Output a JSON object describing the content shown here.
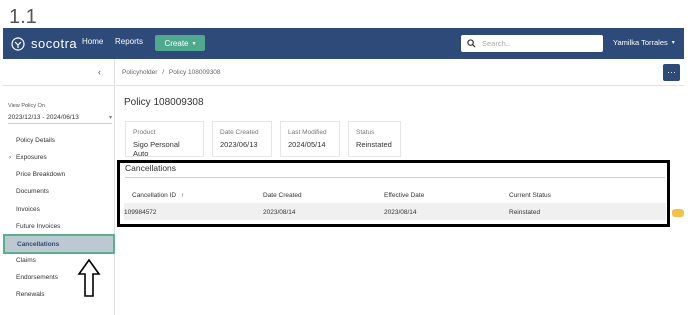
{
  "step": "1.1",
  "header": {
    "brand": "socotra",
    "nav": [
      "Home",
      "Reports"
    ],
    "create_label": "Create",
    "search_placeholder": "Search..",
    "user_name": "Yamilka Torrales"
  },
  "sidebar": {
    "view_policy_label": "View Policy On",
    "date_range": "2023/12/13 - 2024/06/13",
    "items": [
      {
        "label": "Policy Details"
      },
      {
        "label": "Exposures"
      },
      {
        "label": "Price Breakdown"
      },
      {
        "label": "Documents"
      },
      {
        "label": "Invoices"
      },
      {
        "label": "Future Invoices"
      },
      {
        "label": "Cancellations"
      },
      {
        "label": "Claims"
      },
      {
        "label": "Endorsements"
      },
      {
        "label": "Renewals"
      }
    ]
  },
  "breadcrumb": {
    "root": "Policyholder",
    "separator": "/",
    "current": "Policy 108009308"
  },
  "policy": {
    "title": "Policy 108009308",
    "cards": [
      {
        "label": "Product",
        "value": "Sigo Personal Auto"
      },
      {
        "label": "Date Created",
        "value": "2023/06/13"
      },
      {
        "label": "Last Modified",
        "value": "2024/05/14"
      },
      {
        "label": "Status",
        "value": "Reinstated"
      }
    ]
  },
  "cancellations": {
    "title": "Cancellations",
    "columns": [
      "Cancellation ID",
      "Date Created",
      "Effective Date",
      "Current Status"
    ],
    "rows": [
      [
        "109984572",
        "2023/08/14",
        "2023/08/14",
        "Reinstated"
      ]
    ]
  },
  "colors": {
    "nav_bg": "#2e4a79",
    "create_btn": "#4fa98e",
    "active_highlight_border": "#5bb08c",
    "active_bg": "#bcc8d2"
  }
}
